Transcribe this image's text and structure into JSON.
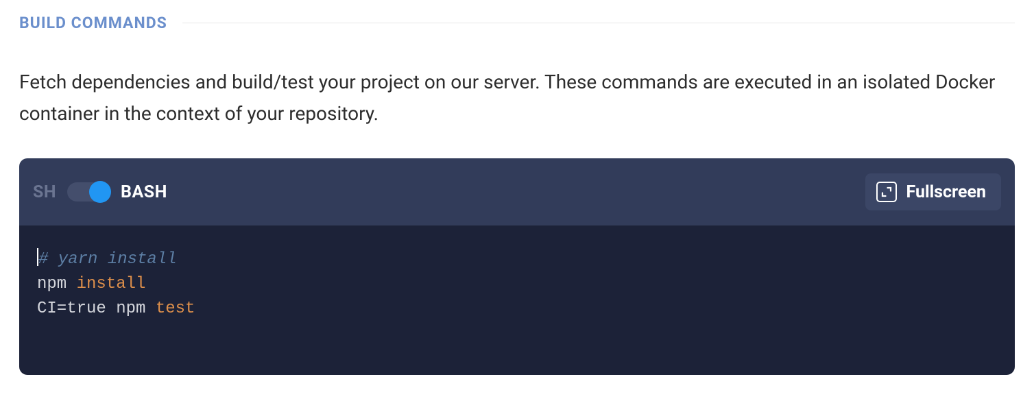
{
  "section": {
    "title": "BUILD COMMANDS",
    "description": "Fetch dependencies and build/test your project on our server. These commands are executed in an isolated Docker container in the context of your repository."
  },
  "toolbar": {
    "shell_sh": "SH",
    "shell_bash": "BASH",
    "fullscreen": "Fullscreen"
  },
  "code": {
    "line1_comment": "# yarn install",
    "line2_a": "npm ",
    "line2_b": "install",
    "line3_a": "CI=true npm ",
    "line3_b": "test"
  }
}
